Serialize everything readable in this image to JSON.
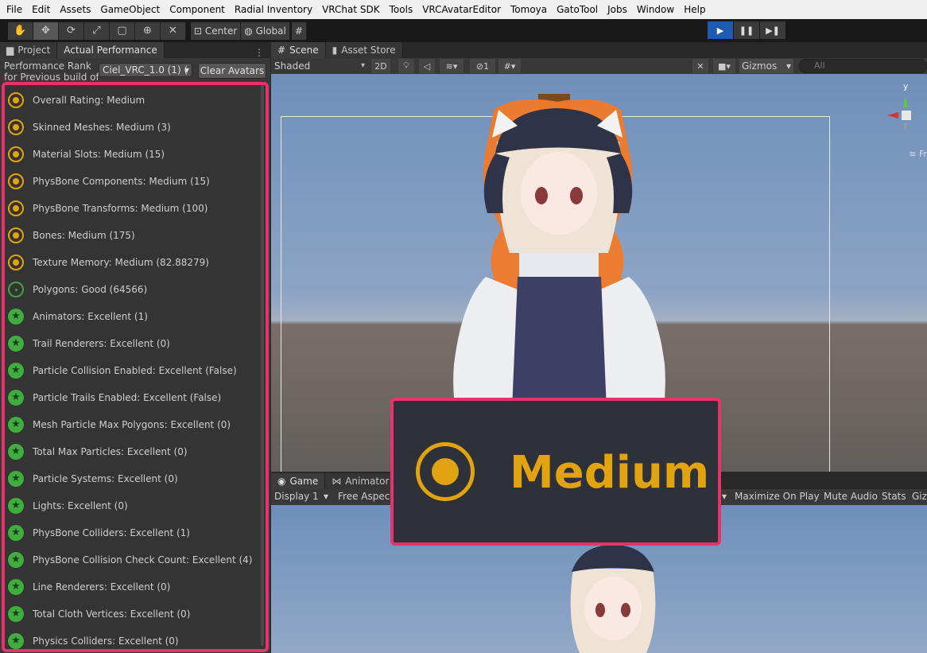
{
  "menu": [
    "File",
    "Edit",
    "Assets",
    "GameObject",
    "Component",
    "Radial Inventory",
    "VRChat SDK",
    "Tools",
    "VRCAvatarEditor",
    "Tomoya",
    "GatoTool",
    "Jobs",
    "Window",
    "Help"
  ],
  "toolbar": {
    "center_label": "Center",
    "global_label": "Global"
  },
  "left_tabs": {
    "project": "Project",
    "actual_performance": "Actual Performance"
  },
  "perf": {
    "rank_label": "Performance Rank for Previous build of",
    "avatar_value": "Ciel_VRC_1.0 (1) (",
    "clear_button": "Clear Avatars"
  },
  "stats": [
    {
      "text": "Overall Rating: Medium",
      "rating": "medium"
    },
    {
      "text": "Skinned Meshes: Medium (3)",
      "rating": "medium"
    },
    {
      "text": "Material Slots: Medium (15)",
      "rating": "medium"
    },
    {
      "text": "PhysBone Components: Medium (15)",
      "rating": "medium"
    },
    {
      "text": "PhysBone Transforms: Medium (100)",
      "rating": "medium"
    },
    {
      "text": "Bones: Medium (175)",
      "rating": "medium"
    },
    {
      "text": "Texture Memory: Medium (82.88279)",
      "rating": "medium"
    },
    {
      "text": "Polygons: Good (64566)",
      "rating": "good"
    },
    {
      "text": "Animators: Excellent (1)",
      "rating": "excellent"
    },
    {
      "text": "Trail Renderers: Excellent (0)",
      "rating": "excellent"
    },
    {
      "text": "Particle Collision Enabled: Excellent (False)",
      "rating": "excellent"
    },
    {
      "text": "Particle Trails Enabled: Excellent (False)",
      "rating": "excellent"
    },
    {
      "text": "Mesh Particle Max Polygons: Excellent (0)",
      "rating": "excellent"
    },
    {
      "text": "Total Max Particles: Excellent (0)",
      "rating": "excellent"
    },
    {
      "text": "Particle Systems: Excellent (0)",
      "rating": "excellent"
    },
    {
      "text": "Lights: Excellent (0)",
      "rating": "excellent"
    },
    {
      "text": "PhysBone Colliders: Excellent (1)",
      "rating": "excellent"
    },
    {
      "text": "PhysBone Collision Check Count: Excellent (4)",
      "rating": "excellent"
    },
    {
      "text": "Line Renderers: Excellent (0)",
      "rating": "excellent"
    },
    {
      "text": "Total Cloth Vertices: Excellent (0)",
      "rating": "excellent"
    },
    {
      "text": "Physics Colliders: Excellent (0)",
      "rating": "excellent"
    }
  ],
  "scene_tabs": {
    "scene": "Scene",
    "asset_store": "Asset Store"
  },
  "scene_toolbar": {
    "shading": "Shaded",
    "mode_2d": "2D",
    "gizmos": "Gizmos",
    "search_placeholder": "All",
    "hidden_count": "1"
  },
  "scene_gizmo": {
    "y": "y",
    "x": "x",
    "persp": "Fr"
  },
  "game_tabs": {
    "game": "Game",
    "animator": "Animator"
  },
  "game_toolbar": {
    "display": "Display 1",
    "aspect": "Free Aspect",
    "maximize": "Maximize On Play",
    "mute": "Mute Audio",
    "stats": "Stats",
    "gizmos": "Giz"
  },
  "callout": {
    "label": "Medium"
  },
  "colors": {
    "highlight": "#e8336a",
    "medium": "#e2a313",
    "good": "#3ea53e",
    "excellent": "#3fae3f"
  }
}
